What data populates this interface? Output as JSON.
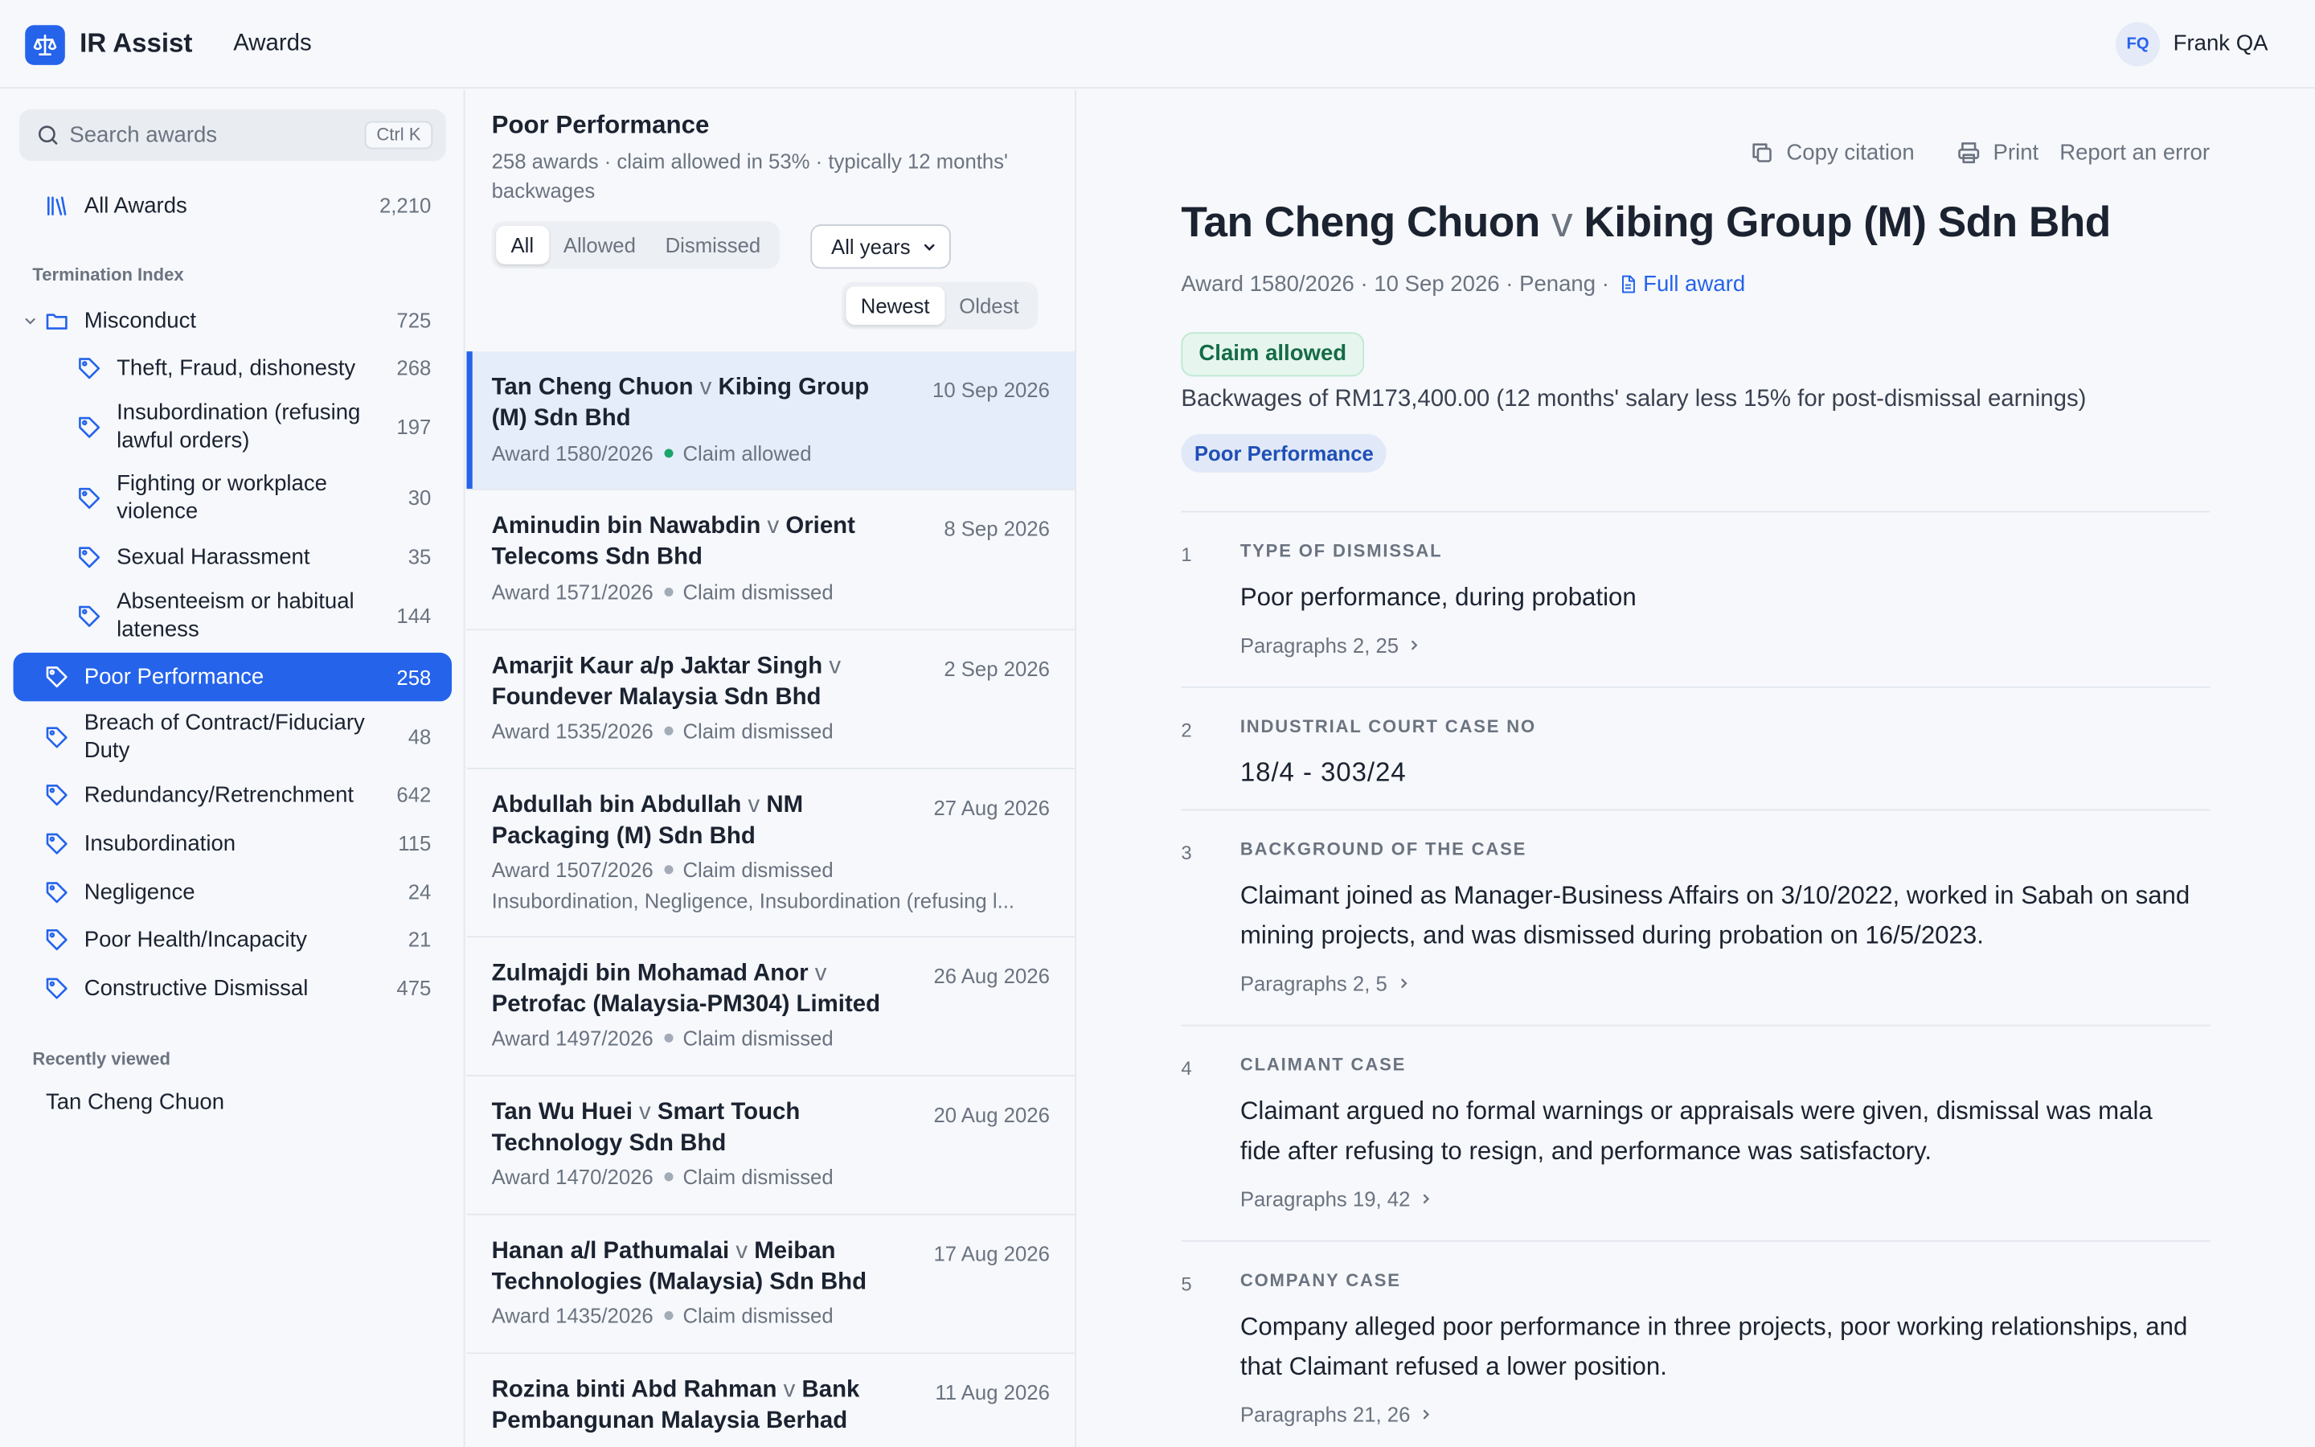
{
  "app": {
    "brand": "IR Assist",
    "nav_awards": "Awards"
  },
  "user": {
    "initials": "FQ",
    "name": "Frank QA"
  },
  "search": {
    "placeholder": "Search awards",
    "shortcut": "Ctrl K"
  },
  "sidebar": {
    "all_awards": {
      "label": "All Awards",
      "count": "2,210"
    },
    "section_title": "Termination Index",
    "misconduct": {
      "label": "Misconduct",
      "count": "725"
    },
    "sub_items": [
      {
        "label": "Theft, Fraud, dishonesty",
        "count": "268"
      },
      {
        "label": "Insubordination (refusing lawful orders)",
        "count": "197"
      },
      {
        "label": "Fighting or workplace violence",
        "count": "30"
      },
      {
        "label": "Sexual Harassment",
        "count": "35"
      },
      {
        "label": "Absenteeism or habitual lateness",
        "count": "144"
      }
    ],
    "items": [
      {
        "label": "Poor Performance",
        "count": "258"
      },
      {
        "label": "Breach of Contract/Fiduciary Duty",
        "count": "48"
      },
      {
        "label": "Redundancy/Retrenchment",
        "count": "642"
      },
      {
        "label": "Insubordination",
        "count": "115"
      },
      {
        "label": "Negligence",
        "count": "24"
      },
      {
        "label": "Poor Health/Incapacity",
        "count": "21"
      },
      {
        "label": "Constructive Dismissal",
        "count": "475"
      }
    ],
    "recent_title": "Recently viewed",
    "recent_items": [
      "Tan Cheng Chuon"
    ]
  },
  "list": {
    "title": "Poor Performance",
    "subtitle": "258 awards · claim allowed in 53% · typically 12 months' backwages",
    "filters": [
      "All",
      "Allowed",
      "Dismissed"
    ],
    "year_select": "All years",
    "sort": [
      "Newest",
      "Oldest"
    ],
    "rows": [
      {
        "claimant": "Tan Cheng Chuon",
        "v": "v",
        "respondent": "Kibing Group (M) Sdn Bhd",
        "date": "10 Sep 2026",
        "award": "Award 1580/2026",
        "outcome": "Claim allowed"
      },
      {
        "claimant": "Aminudin bin Nawabdin",
        "v": "v",
        "respondent": "Orient Telecoms Sdn Bhd",
        "date": "8 Sep 2026",
        "award": "Award 1571/2026",
        "outcome": "Claim dismissed"
      },
      {
        "claimant": "Amarjit Kaur a/p Jaktar Singh",
        "v": "v",
        "respondent": "Foundever Malaysia Sdn Bhd",
        "date": "2 Sep 2026",
        "award": "Award 1535/2026",
        "outcome": "Claim dismissed"
      },
      {
        "claimant": "Abdullah bin Abdullah",
        "v": "v",
        "respondent": "NM Packaging (M) Sdn Bhd",
        "date": "27 Aug 2026",
        "award": "Award 1507/2026",
        "outcome": "Claim dismissed",
        "tags": "Insubordination, Negligence, Insubordination (refusing l..."
      },
      {
        "claimant": "Zulmajdi bin Mohamad Anor",
        "v": "v",
        "respondent": "Petrofac (Malaysia-PM304) Limited",
        "date": "26 Aug 2026",
        "award": "Award 1497/2026",
        "outcome": "Claim dismissed"
      },
      {
        "claimant": "Tan Wu Huei",
        "v": "v",
        "respondent": "Smart Touch Technology Sdn Bhd",
        "date": "20 Aug 2026",
        "award": "Award 1470/2026",
        "outcome": "Claim dismissed"
      },
      {
        "claimant": "Hanan a/l Pathumalai",
        "v": "v",
        "respondent": "Meiban Technologies (Malaysia) Sdn Bhd",
        "date": "17 Aug 2026",
        "award": "Award 1435/2026",
        "outcome": "Claim dismissed"
      },
      {
        "claimant": "Rozina binti Abd Rahman",
        "v": "v",
        "respondent": "Bank Pembangunan Malaysia Berhad",
        "date": "11 Aug 2026",
        "award": "",
        "outcome": ""
      }
    ]
  },
  "detail": {
    "actions": {
      "copy": "Copy citation",
      "print": "Print",
      "report": "Report an error"
    },
    "claimant": "Tan Cheng Chuon",
    "v": "v",
    "respondent": "Kibing Group (M) Sdn Bhd",
    "meta": "Award 1580/2026 · 10 Sep 2026 · Penang ·",
    "full_award": "Full award",
    "outcome": "Claim allowed",
    "backwages": "Backwages of RM173,400.00 (12 months' salary less 15% for post-dismissal earnings)",
    "category": "Poor Performance",
    "sections": [
      {
        "num": "1",
        "head": "TYPE OF DISMISSAL",
        "body": "Poor performance, during probation",
        "paras": "Paragraphs 2, 25"
      },
      {
        "num": "2",
        "head": "INDUSTRIAL COURT CASE NO",
        "body": "18/4 - 303/24",
        "paras": ""
      },
      {
        "num": "3",
        "head": "BACKGROUND OF THE CASE",
        "body": "Claimant joined as Manager-Business Affairs on 3/10/2022, worked in Sabah on sand mining projects, and was dismissed during probation on 16/5/2023.",
        "paras": "Paragraphs 2, 5"
      },
      {
        "num": "4",
        "head": "CLAIMANT CASE",
        "body": "Claimant argued no formal warnings or appraisals were given, dismissal was mala fide after refusing to resign, and performance was satisfactory.",
        "paras": "Paragraphs 19, 42"
      },
      {
        "num": "5",
        "head": "COMPANY CASE",
        "body": "Company alleged poor performance in three projects, poor working relationships, and that Claimant refused a lower position.",
        "paras": "Paragraphs 21, 26"
      }
    ]
  },
  "colors": {
    "accent": "#2563eb",
    "allowed": "#1aa56b",
    "muted": "#6b7380"
  }
}
